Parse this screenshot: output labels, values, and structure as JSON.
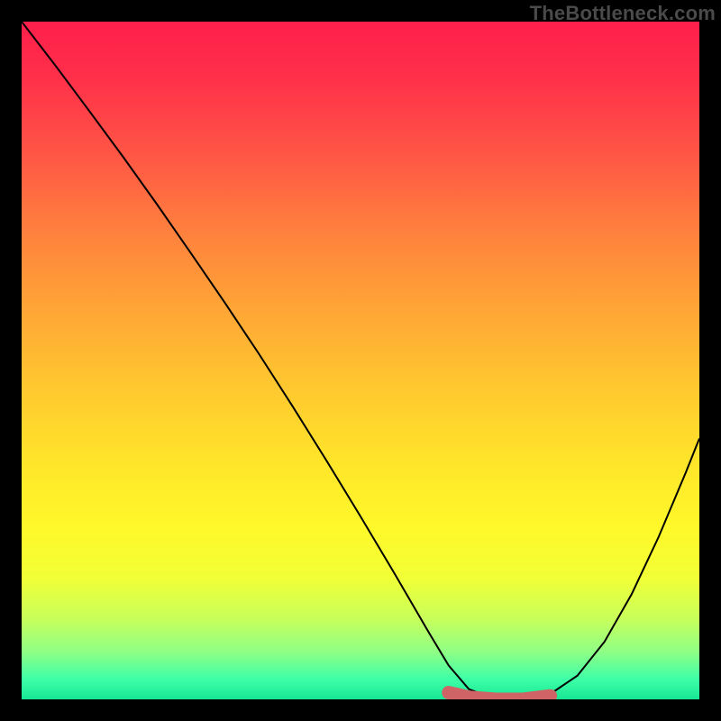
{
  "watermark": "TheBottleneck.com",
  "colors": {
    "background": "#000000",
    "curve": "#000000",
    "marker": "#cf6365",
    "gradient_top": "#ff1f4b",
    "gradient_bottom": "#18e694"
  },
  "chart_data": {
    "type": "line",
    "title": "",
    "xlabel": "",
    "ylabel": "",
    "xlim": [
      0,
      100
    ],
    "ylim": [
      0,
      100
    ],
    "annotations": [],
    "series": [
      {
        "name": "bottleneck-curve",
        "x": [
          0,
          5,
          10,
          15,
          20,
          25,
          30,
          35,
          40,
          45,
          50,
          55,
          60,
          63,
          66,
          70,
          74,
          78,
          82,
          86,
          90,
          94,
          98,
          100
        ],
        "y": [
          100,
          93.5,
          86.8,
          80.0,
          73.0,
          65.8,
          58.5,
          51.0,
          43.2,
          35.2,
          27.0,
          18.6,
          10.0,
          5.0,
          1.5,
          0.0,
          0.0,
          0.8,
          3.5,
          8.5,
          15.5,
          24.0,
          33.5,
          38.5
        ]
      }
    ],
    "marker": {
      "name": "optimal-range",
      "x": [
        63,
        66,
        70,
        74,
        78
      ],
      "y": [
        1.0,
        0.3,
        0.0,
        0.0,
        0.5
      ]
    }
  }
}
